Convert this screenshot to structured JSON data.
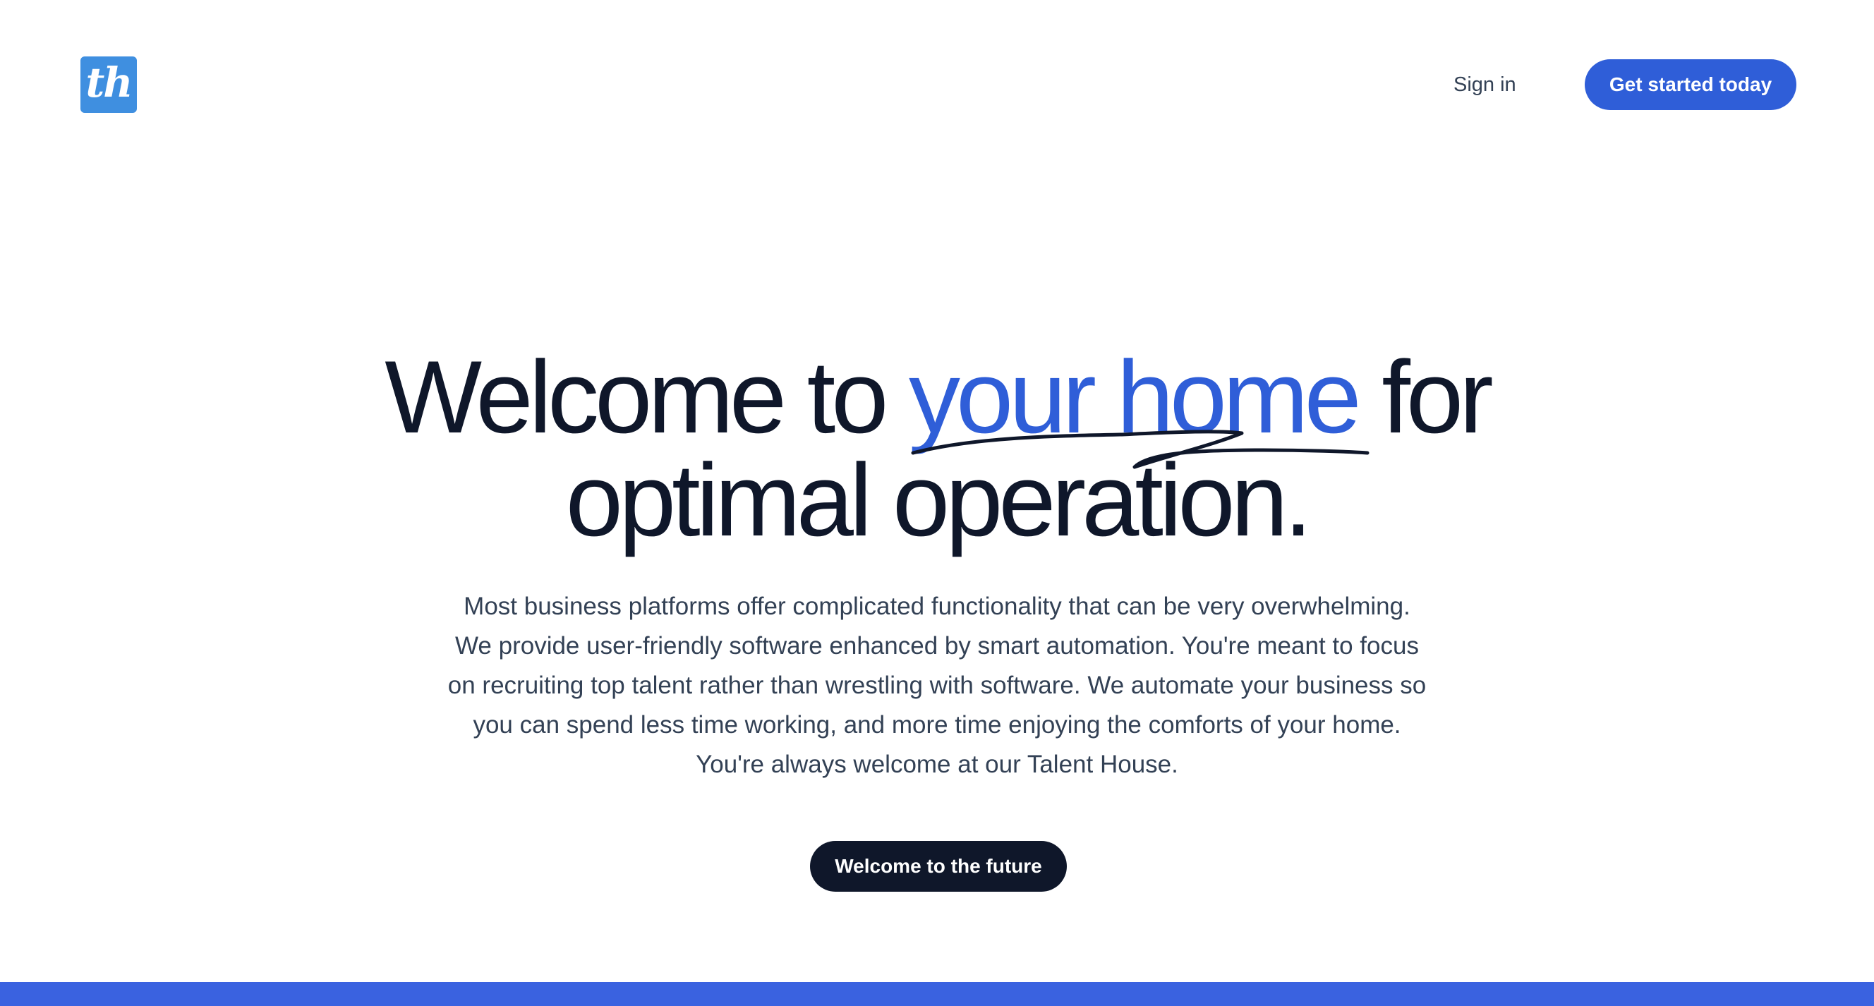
{
  "header": {
    "logo_text": "th",
    "sign_in_label": "Sign in",
    "cta_label": "Get started today"
  },
  "hero": {
    "headline_before": "Welcome to ",
    "headline_accent": "your home",
    "headline_after": " for",
    "headline_line2": "optimal operation.",
    "paragraph": "Most business platforms offer complicated functionality that can be very overwhelming. We provide user-friendly software enhanced by smart automation. You're meant to focus on recruiting top talent rather than wrestling with software. We automate your business so you can spend less time working, and more time enjoying the comforts of your home. You're always welcome at our Talent House.",
    "cta_label": "Welcome to the future"
  },
  "colors": {
    "accent": "#2f5ed8",
    "dark": "#0f172a",
    "logo_bg": "#3f8fe0",
    "body_text": "#334155",
    "bottom_band": "#3a62e0"
  },
  "icons": {
    "logo": "talent-house-logo-icon",
    "underline": "hand-drawn-scribble-icon"
  }
}
